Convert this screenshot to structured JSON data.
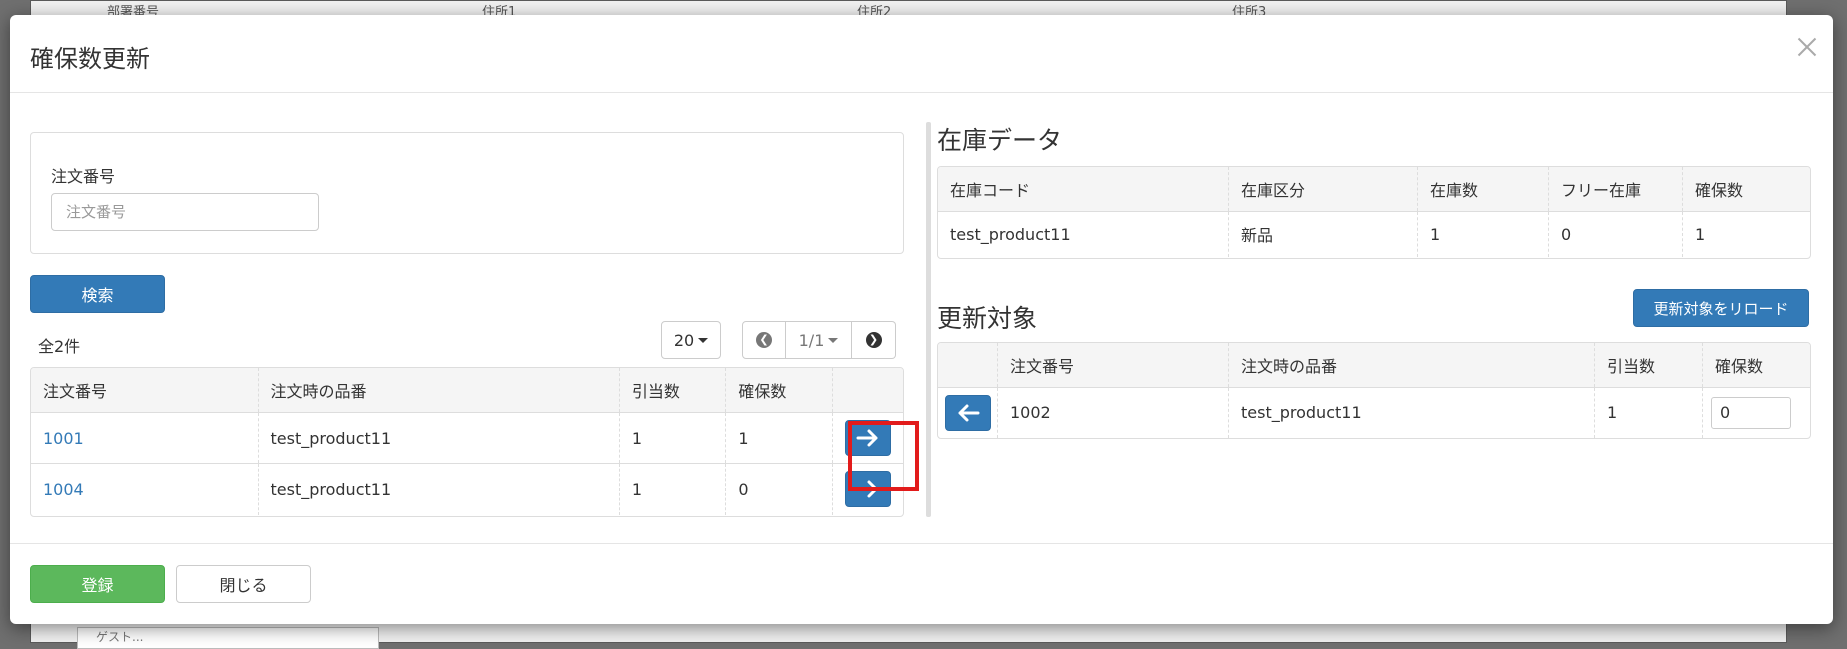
{
  "backdrop": {
    "header_cells": [
      "部署番号",
      "住所1",
      "住所2",
      "住所3"
    ],
    "bottom_input": "ゲスト..."
  },
  "modal": {
    "title": "確保数更新",
    "close_icon": "close-icon"
  },
  "search": {
    "label": "注文番号",
    "placeholder": "注文番号",
    "value": "",
    "button": "検索"
  },
  "result": {
    "count": "全2件",
    "per_page": "20",
    "page": "1/1"
  },
  "orders": {
    "columns": [
      "注文番号",
      "注文時の品番",
      "引当数",
      "確保数",
      ""
    ],
    "rows": [
      {
        "order_no": "1001",
        "product": "test_product11",
        "allocated": "1",
        "reserved": "1"
      },
      {
        "order_no": "1004",
        "product": "test_product11",
        "allocated": "1",
        "reserved": "0"
      }
    ]
  },
  "stock": {
    "title": "在庫データ",
    "columns": [
      "在庫コード",
      "在庫区分",
      "在庫数",
      "フリー在庫",
      "確保数"
    ],
    "rows": [
      {
        "code": "test_product11",
        "category": "新品",
        "qty": "1",
        "free": "0",
        "reserved": "1"
      }
    ]
  },
  "targets": {
    "title": "更新対象",
    "reload_button": "更新対象をリロード",
    "columns": [
      "",
      "注文番号",
      "注文時の品番",
      "引当数",
      "確保数"
    ],
    "rows": [
      {
        "order_no": "1002",
        "product": "test_product11",
        "allocated": "1",
        "reserved_input": "0"
      }
    ]
  },
  "footer": {
    "register": "登録",
    "close": "閉じる"
  },
  "colors": {
    "primary": "#337ab7",
    "success": "#5cb85c",
    "highlight": "#e21b1b"
  }
}
